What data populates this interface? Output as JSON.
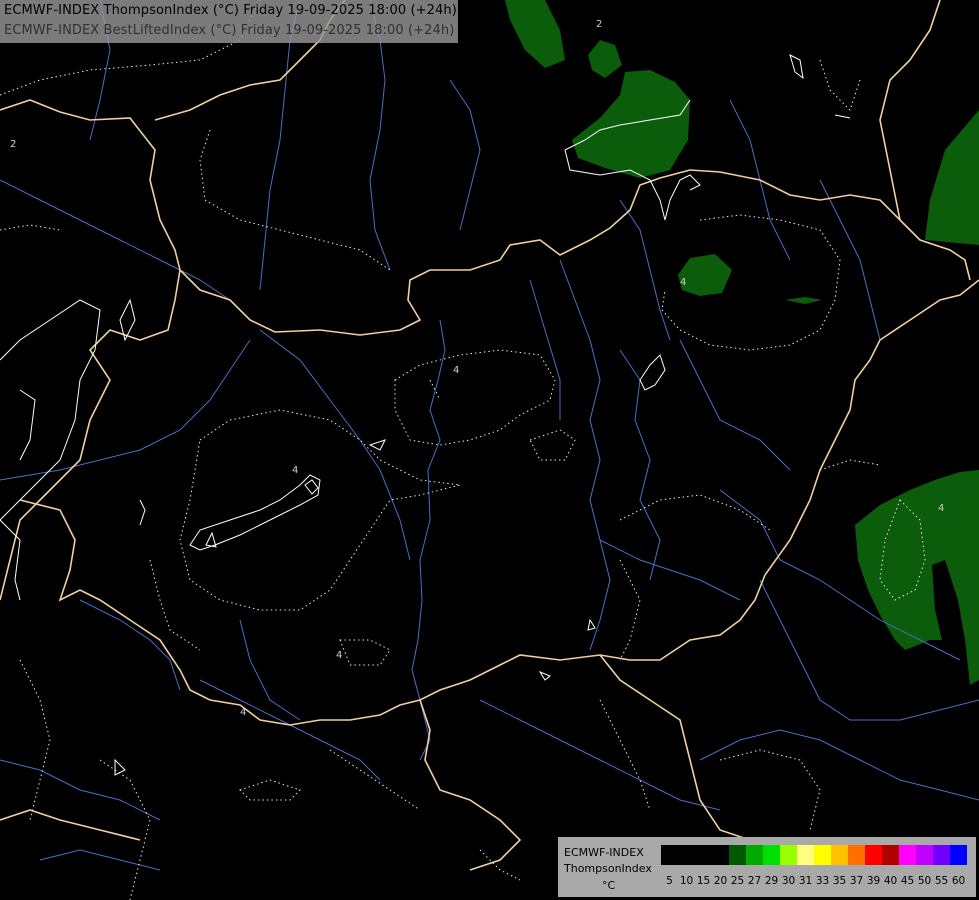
{
  "header": {
    "title_line1": "ECMWF-INDEX ThompsonIndex (°C) Friday 19-09-2025 18:00 (+24h)",
    "title_line2": "ECMWF-INDEX BestLiftedIndex (°C) Friday 19-09-2025 18:00 (+24h)"
  },
  "legend": {
    "model": "ECMWF-INDEX",
    "parameter": "ThompsonIndex",
    "unit": "°C",
    "steps": [
      {
        "value": "5",
        "color": "#000000"
      },
      {
        "value": "10",
        "color": "#000000"
      },
      {
        "value": "15",
        "color": "#000000"
      },
      {
        "value": "20",
        "color": "#000000"
      },
      {
        "value": "25",
        "color": "#005a00"
      },
      {
        "value": "27",
        "color": "#00aa00"
      },
      {
        "value": "29",
        "color": "#00e000"
      },
      {
        "value": "30",
        "color": "#9aff00"
      },
      {
        "value": "31",
        "color": "#ffff80"
      },
      {
        "value": "33",
        "color": "#ffff00"
      },
      {
        "value": "35",
        "color": "#ffc000"
      },
      {
        "value": "37",
        "color": "#ff7000"
      },
      {
        "value": "39",
        "color": "#ff0000"
      },
      {
        "value": "40",
        "color": "#b00000"
      },
      {
        "value": "45",
        "color": "#ff00ff"
      },
      {
        "value": "50",
        "color": "#c000ff"
      },
      {
        "value": "55",
        "color": "#7000ff"
      },
      {
        "value": "60",
        "color": "#0000ff"
      }
    ]
  },
  "contour_labels": [
    "2",
    "2",
    "4",
    "4",
    "4",
    "4",
    "4",
    "4"
  ],
  "colors": {
    "background": "#000000",
    "border": "#f2cfa0",
    "river": "#4a6ec8",
    "shading_dark_green": "#005a00",
    "contour": "#ffffff"
  }
}
